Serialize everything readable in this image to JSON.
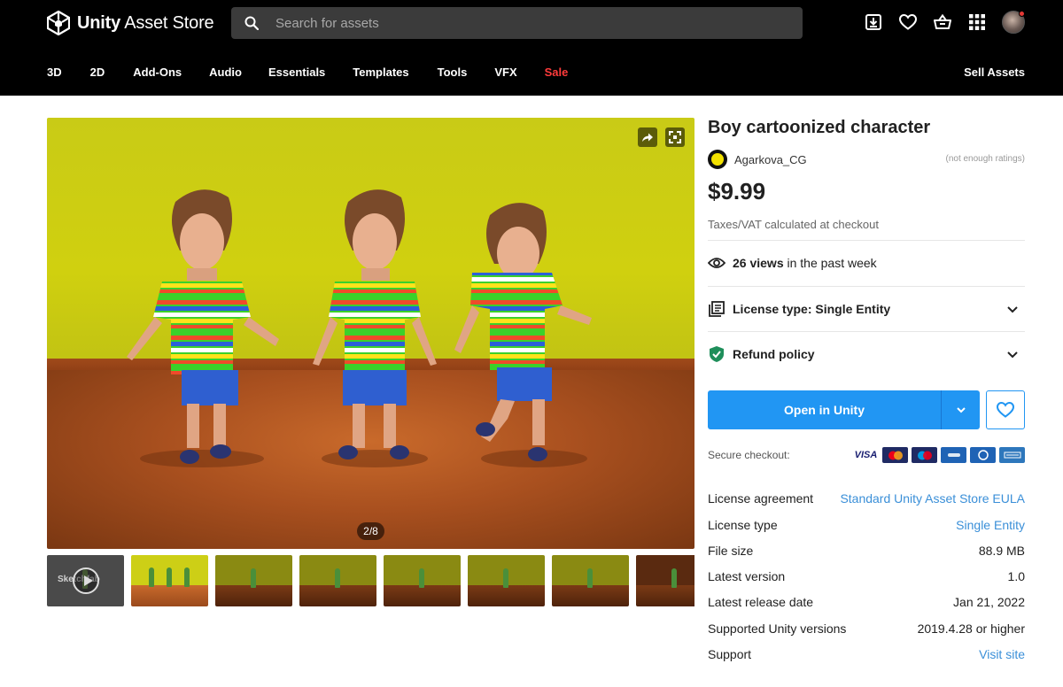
{
  "header": {
    "logo_strong": "Unity",
    "logo_rest": " Asset Store",
    "search_placeholder": "Search for assets",
    "nav": [
      "3D",
      "2D",
      "Add-Ons",
      "Audio",
      "Essentials",
      "Templates",
      "Tools",
      "VFX",
      "Sale"
    ],
    "sale_color": "#ff3b3b",
    "sell_label": "Sell Assets"
  },
  "gallery": {
    "counter": "2/8",
    "thumb_overlay": "Sketchfab"
  },
  "product": {
    "title": "Boy cartoonized character",
    "publisher": "Agarkova_CG",
    "ratings": "(not enough ratings)",
    "price": "$9.99",
    "vat": "Taxes/VAT calculated at checkout",
    "views_count": "26 views",
    "views_suffix": " in the past week",
    "license_row": "License type: Single Entity",
    "refund_row": "Refund policy",
    "cta_label": "Open in Unity",
    "secure_label": "Secure checkout:",
    "payments": [
      "VISA",
      "Mastercard",
      "Maestro",
      "PayPal",
      "Diners",
      "Amex"
    ],
    "accent_color": "#2196f3",
    "refund_color": "#1e8e5a"
  },
  "details": [
    {
      "key": "License agreement",
      "value": "Standard Unity Asset Store EULA",
      "link": true
    },
    {
      "key": "License type",
      "value": "Single Entity",
      "link": true
    },
    {
      "key": "File size",
      "value": "88.9 MB",
      "link": false
    },
    {
      "key": "Latest version",
      "value": "1.0",
      "link": false
    },
    {
      "key": "Latest release date",
      "value": "Jan 21, 2022",
      "link": false
    },
    {
      "key": "Supported Unity versions",
      "value": "2019.4.28 or higher",
      "link": false
    },
    {
      "key": "Support",
      "value": "Visit site",
      "link": true
    }
  ]
}
